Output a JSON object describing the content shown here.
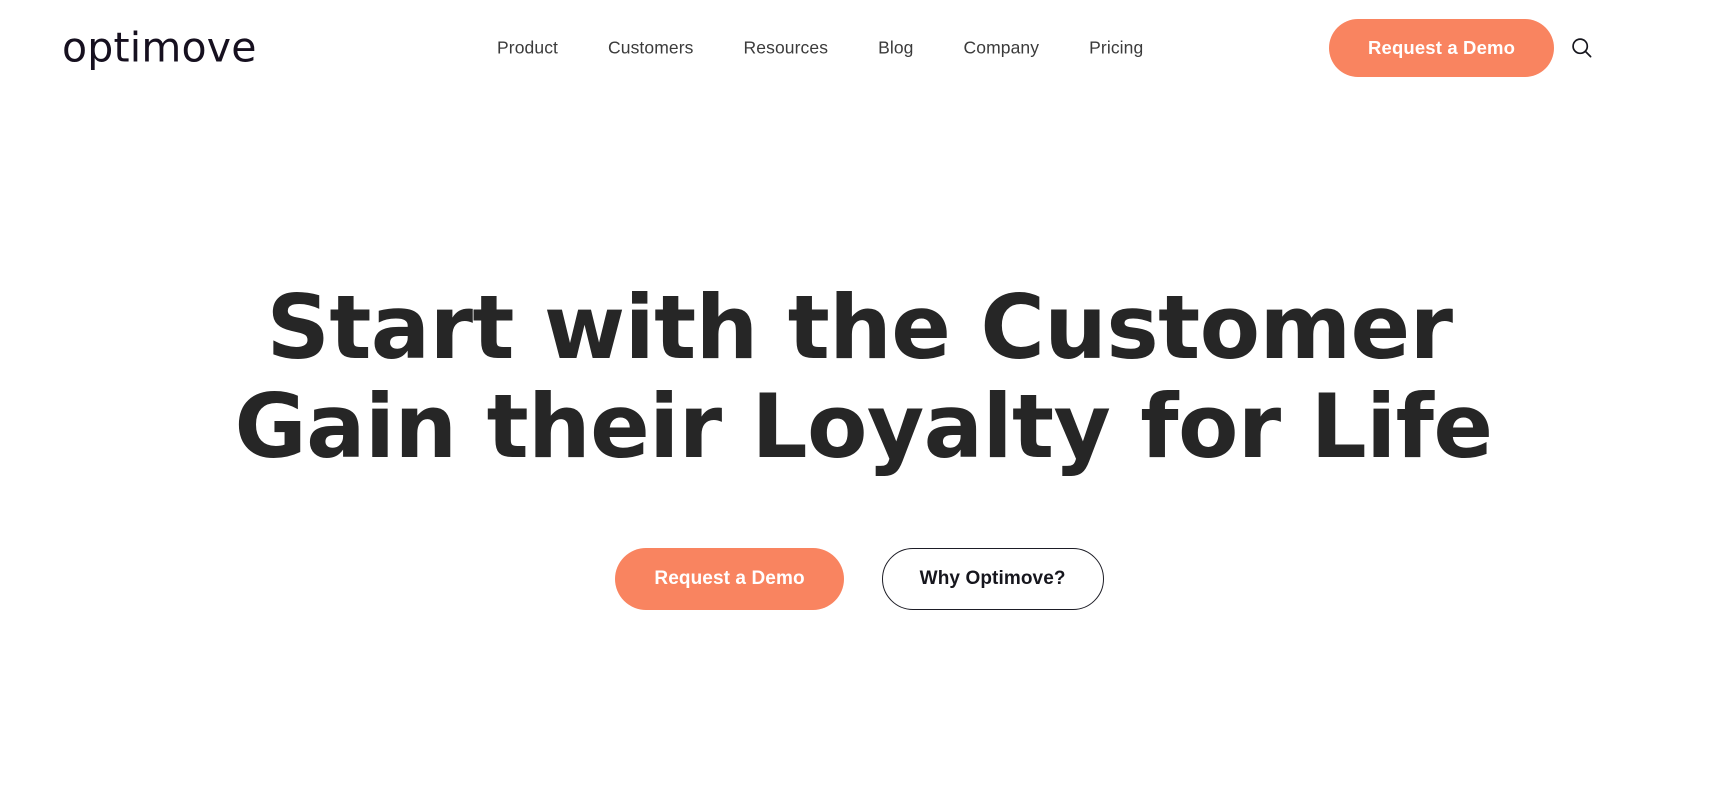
{
  "brand": {
    "logo_text": "optimove",
    "accent_color": "#f98460",
    "text_color": "#262626",
    "logo_color": "#16101f"
  },
  "header": {
    "nav_items": [
      {
        "label": "Product"
      },
      {
        "label": "Customers"
      },
      {
        "label": "Resources"
      },
      {
        "label": "Blog"
      },
      {
        "label": "Company"
      },
      {
        "label": "Pricing"
      }
    ],
    "demo_button_label": "Request a Demo",
    "search_icon": "search-icon"
  },
  "hero": {
    "headline_line_1": "Start with the Customer",
    "headline_line_2": "Gain their Loyalty for Life",
    "primary_cta_label": "Request a Demo",
    "secondary_cta_label": "Why Optimove?"
  }
}
